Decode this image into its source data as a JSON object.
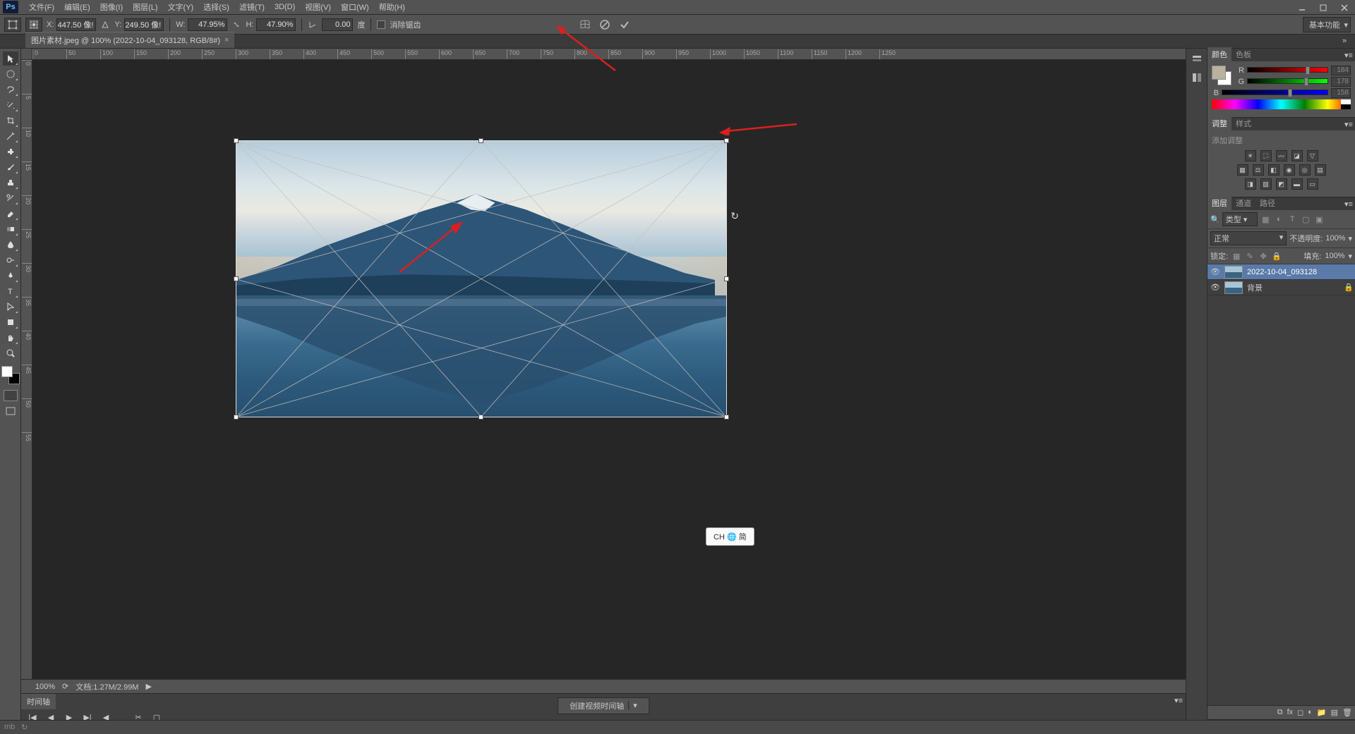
{
  "menu": {
    "file": "文件(F)",
    "edit": "编辑(E)",
    "image": "图像(I)",
    "layer": "图层(L)",
    "type": "文字(Y)",
    "select": "选择(S)",
    "filter": "滤镜(T)",
    "3d": "3D(D)",
    "view": "视图(V)",
    "window": "窗口(W)",
    "help": "帮助(H)"
  },
  "options": {
    "x_label": "X:",
    "x_val": "447.50 像!",
    "y_label": "Y:",
    "y_val": "249.50 像!",
    "w_label": "W:",
    "w_val": "47.95%",
    "h_label": "H:",
    "h_val": "47.90%",
    "angle_val": "0.00",
    "angle_unit": "度",
    "antialias": "消除锯齿",
    "workspace": "基本功能"
  },
  "doc_tab": {
    "title": "图片素材.jpeg @ 100% (2022-10-04_093128, RGB/8#)",
    "close": "×"
  },
  "ruler_h": [
    "0",
    "50",
    "100",
    "150",
    "200",
    "250",
    "300",
    "350",
    "400",
    "450",
    "500",
    "550",
    "600",
    "650",
    "700",
    "750",
    "800",
    "850",
    "900",
    "950",
    "1000",
    "1050",
    "1100",
    "1150",
    "1200",
    "1250"
  ],
  "ruler_v": [
    "0",
    "5",
    "10",
    "15",
    "20",
    "25",
    "30",
    "35",
    "40",
    "45",
    "50",
    "55"
  ],
  "status": {
    "zoom": "100%",
    "doc_info": "文档:1.27M/2.99M"
  },
  "timeline": {
    "tab": "时间轴",
    "create": "创建视频时间轴"
  },
  "panels": {
    "color_tab": "颜色",
    "swatches_tab": "色板",
    "rgb": {
      "r_label": "R",
      "r_val": "184",
      "g_label": "G",
      "g_val": "178",
      "b_label": "B",
      "b_val": "158"
    },
    "adjust_tab": "调整",
    "styles_tab": "样式",
    "adjust_title": "添加调整",
    "layers_tab": "图层",
    "channels_tab": "通道",
    "paths_tab": "路径",
    "filter_label": "类型",
    "blend_mode": "正常",
    "opacity_label": "不透明度:",
    "opacity_val": "100%",
    "lock_label": "锁定:",
    "fill_label": "填充:",
    "fill_val": "100%",
    "layer1": "2022-10-04_093128",
    "layer2": "背景"
  },
  "ime": "CH 🌐 简"
}
